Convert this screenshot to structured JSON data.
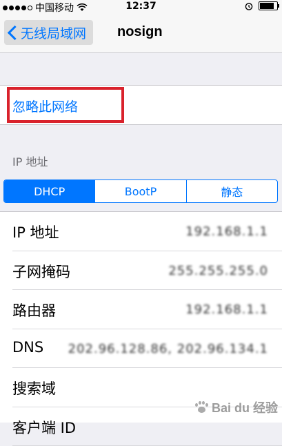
{
  "status_bar": {
    "carrier": "中国移动",
    "time": "12:37",
    "battery_level": 0.85
  },
  "nav": {
    "back_label": "无线局域网",
    "title": "nosign"
  },
  "forget": {
    "label": "忽略此网络"
  },
  "ip_section": {
    "header": "IP 地址",
    "segments": [
      "DHCP",
      "BootP",
      "静态"
    ],
    "selected_segment": "DHCP",
    "rows": [
      {
        "label": "IP 地址",
        "value": "192.168.1.1"
      },
      {
        "label": "子网掩码",
        "value": "255.255.255.0"
      },
      {
        "label": "路由器",
        "value": "192.168.1.1"
      },
      {
        "label": "DNS",
        "value": "202.96.128.86, 202.96.134.1"
      },
      {
        "label": "搜索域",
        "value": ""
      },
      {
        "label": "客户端 ID",
        "value": ""
      }
    ]
  },
  "watermark": {
    "text": "Bai du 经验"
  },
  "colors": {
    "accent": "#0076ff",
    "highlight": "#d9222c",
    "background": "#efeff4"
  }
}
